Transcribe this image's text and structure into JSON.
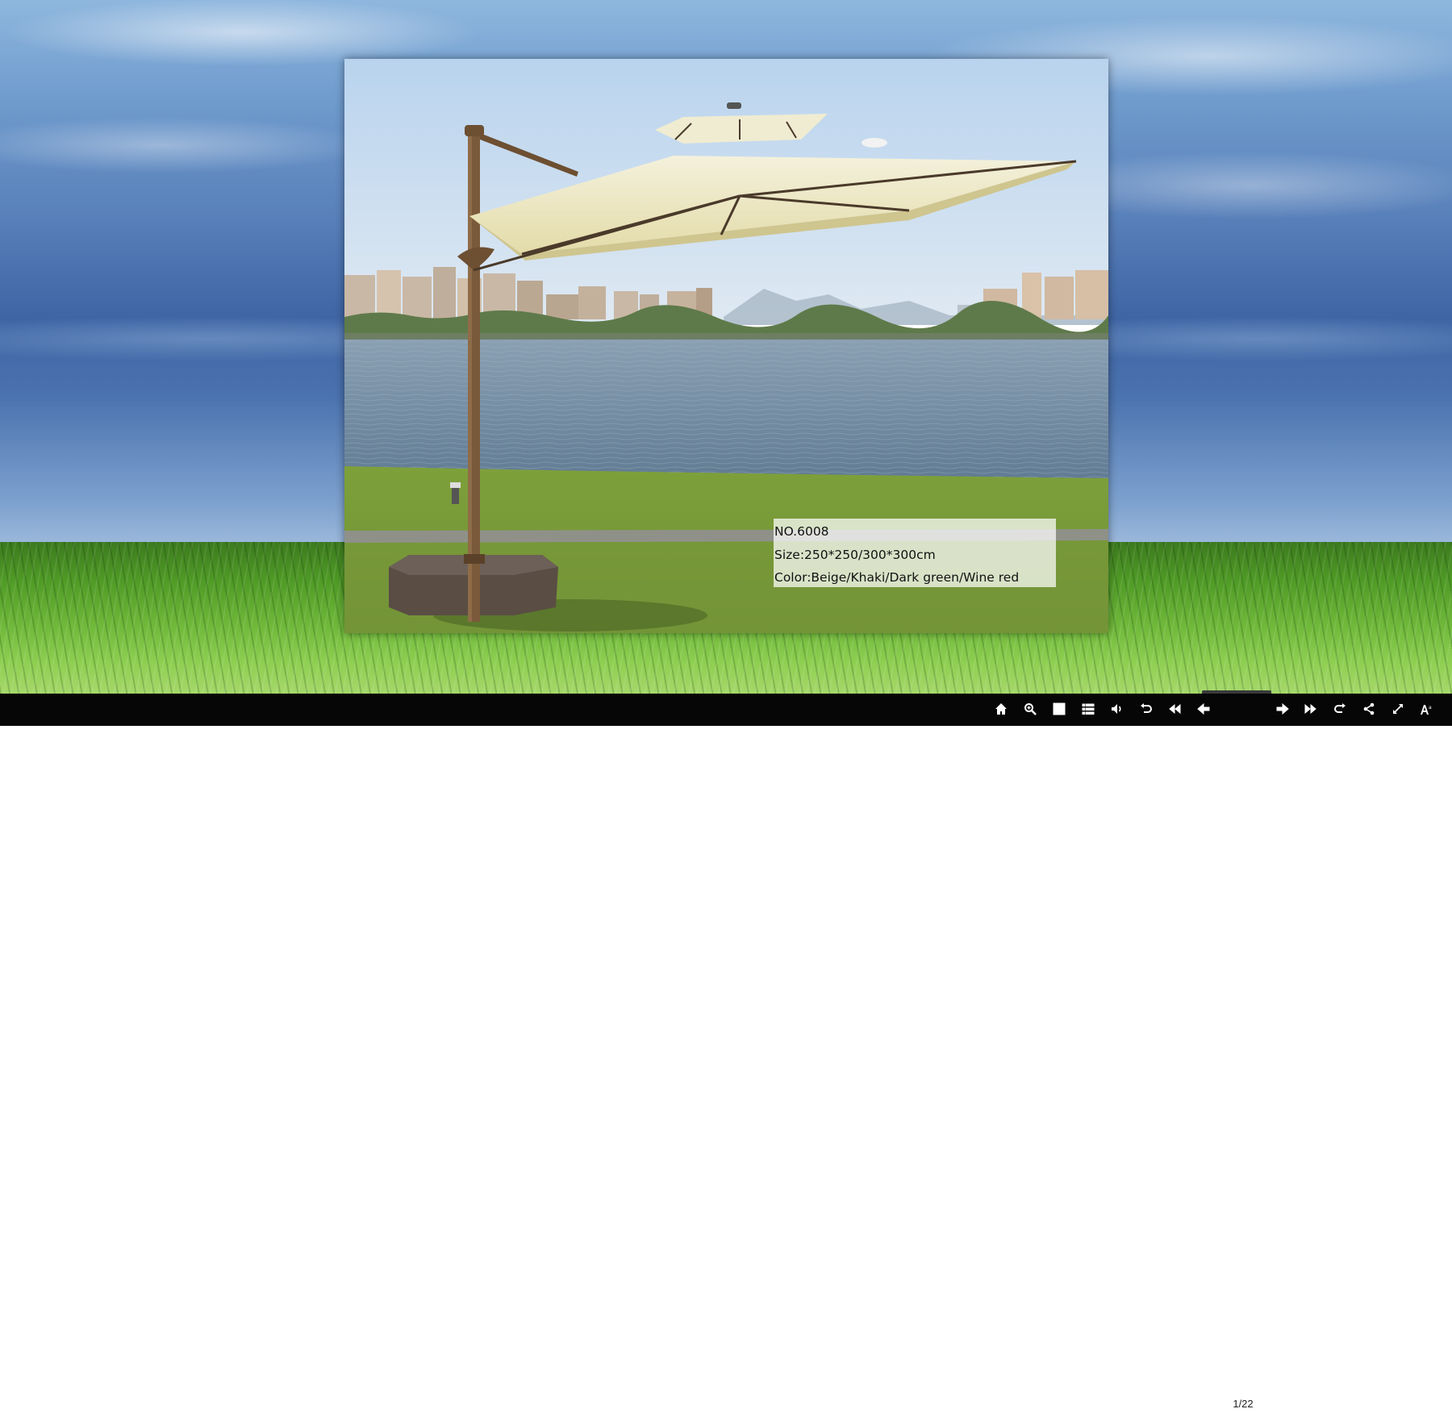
{
  "caption": {
    "model": "NO.6008",
    "size": "Size:250*250/300*300cm",
    "color": "Color:Beige/Khaki/Dark green/Wine red"
  },
  "toolbar": {
    "page_indicator": "1/22",
    "buttons": [
      {
        "name": "home",
        "icon": "home-icon"
      },
      {
        "name": "zoom",
        "icon": "zoom-icon"
      },
      {
        "name": "thumbnails",
        "icon": "grid-icon"
      },
      {
        "name": "table-of-contents",
        "icon": "list-icon"
      },
      {
        "name": "sound",
        "icon": "speaker-icon"
      },
      {
        "name": "undo",
        "icon": "undo-icon"
      },
      {
        "name": "first-page",
        "icon": "double-left-icon"
      },
      {
        "name": "previous-page",
        "icon": "arrow-left-icon"
      },
      {
        "name": "next-page",
        "icon": "arrow-right-icon"
      },
      {
        "name": "last-page",
        "icon": "double-right-icon"
      },
      {
        "name": "redo",
        "icon": "redo-icon"
      },
      {
        "name": "share",
        "icon": "share-icon"
      },
      {
        "name": "fullscreen",
        "icon": "fullscreen-icon"
      },
      {
        "name": "font-size",
        "icon": "text-size-icon"
      }
    ]
  }
}
